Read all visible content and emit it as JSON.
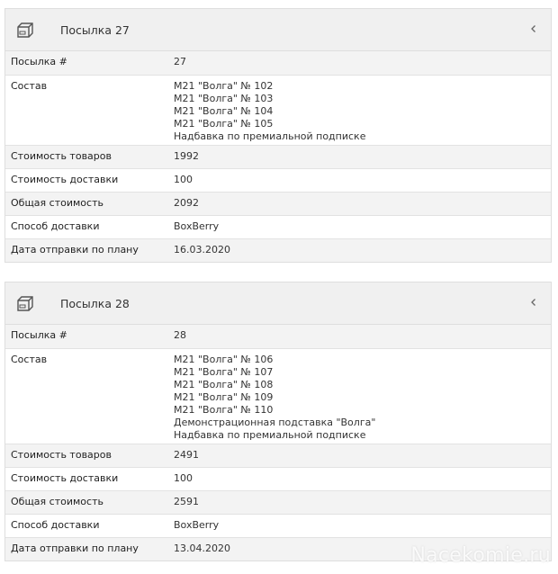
{
  "watermark": "Nacekomie.ru",
  "parcels": [
    {
      "title": "Посылка 27",
      "rows": [
        {
          "label": "Посылка #",
          "value": [
            "27"
          ]
        },
        {
          "label": "Состав",
          "value": [
            "M21 \"Волга\" № 102",
            "M21 \"Волга\" № 103",
            "M21 \"Волга\" № 104",
            "M21 \"Волга\" № 105",
            "Надбавка по премиальной подписке"
          ]
        },
        {
          "label": "Стоимость товаров",
          "value": [
            "1992"
          ]
        },
        {
          "label": "Стоимость доставки",
          "value": [
            "100"
          ]
        },
        {
          "label": "Общая стоимость",
          "value": [
            "2092"
          ]
        },
        {
          "label": "Способ доставки",
          "value": [
            "BoxBerry"
          ]
        },
        {
          "label": "Дата отправки по плану",
          "value": [
            "16.03.2020"
          ]
        }
      ]
    },
    {
      "title": "Посылка 28",
      "rows": [
        {
          "label": "Посылка #",
          "value": [
            "28"
          ]
        },
        {
          "label": "Состав",
          "value": [
            "M21 \"Волга\" № 106",
            "M21 \"Волга\" № 107",
            "M21 \"Волга\" № 108",
            "M21 \"Волга\" № 109",
            "M21 \"Волга\" № 110",
            "Демонстрационная подставка \"Волга\"",
            "Надбавка по премиальной подписке"
          ]
        },
        {
          "label": "Стоимость товаров",
          "value": [
            "2491"
          ]
        },
        {
          "label": "Стоимость доставки",
          "value": [
            "100"
          ]
        },
        {
          "label": "Общая стоимость",
          "value": [
            "2591"
          ]
        },
        {
          "label": "Способ доставки",
          "value": [
            "BoxBerry"
          ]
        },
        {
          "label": "Дата отправки по плану",
          "value": [
            "13.04.2020"
          ]
        }
      ]
    }
  ]
}
